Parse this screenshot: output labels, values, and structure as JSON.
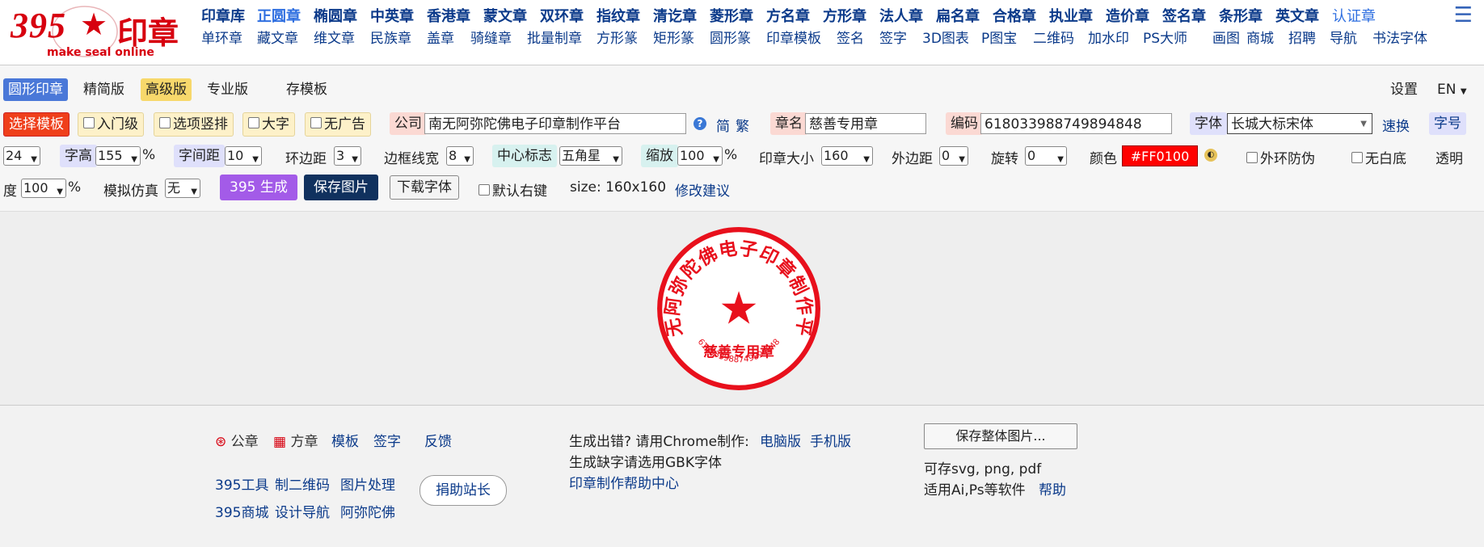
{
  "logo": {
    "number": "395",
    "star": "★",
    "text": "印章",
    "subtitle": "make seal online"
  },
  "nav_row1": [
    "印章库",
    "正圆章",
    "椭圆章",
    "中英章",
    "香港章",
    "蒙文章",
    "双环章",
    "指纹章",
    "清讫章",
    "菱形章",
    "方名章",
    "方形章",
    "法人章",
    "扁名章",
    "合格章",
    "执业章",
    "造价章",
    "签名章",
    "条形章",
    "英文章",
    "认证章"
  ],
  "nav_row2": [
    "单环章",
    "藏文章",
    "维文章",
    "民族章",
    "盖章",
    "骑缝章",
    "批量制章",
    "方形篆",
    "矩形篆",
    "圆形篆",
    "印章模板",
    "签名",
    "签字",
    "3D图表",
    "P图宝",
    "二维码",
    "加水印",
    "PS大师",
    "画图",
    "商城",
    "招聘",
    "导航",
    "书法字体"
  ],
  "menu_icon": "menu-icon",
  "tabs": {
    "round": "圆形印章",
    "simple": "精简版",
    "advanced": "高级版",
    "pro": "专业版",
    "save_tpl": "存模板",
    "settings": "设置",
    "lang": "EN"
  },
  "row2": {
    "choose_template": "选择模板",
    "beginner": "入门级",
    "vertical": "选项竖排",
    "large": "大字",
    "no_ads": "无广告",
    "company_label": "公司",
    "company_value": "南无阿弥陀佛电子印章制作平台",
    "simplified": "简",
    "traditional": "繁",
    "name_label": "章名",
    "name_value": "慈善专用章",
    "code_label": "编码",
    "code_value": "618033988749894848",
    "font_label": "字体",
    "font_value": "长城大标宋体",
    "quick": "速换",
    "size_label": "字号"
  },
  "row3": {
    "font_size": "24",
    "char_height_label": "字高",
    "char_height": "155",
    "pct": "%",
    "spacing_label": "字间距",
    "spacing": "10",
    "ring_margin_label": "环边距",
    "ring_margin": "3",
    "border_label": "边框线宽",
    "border": "8",
    "center_label": "中心标志",
    "center": "五角星",
    "zoom_label": "缩放",
    "zoom": "100",
    "seal_size_label": "印章大小",
    "seal_size": "160",
    "outer_margin_label": "外边距",
    "outer_margin": "0",
    "rotate_label": "旋转",
    "rotate": "0",
    "color_label": "颜色",
    "color_value": "#FF0100",
    "anti_fake": "外环防伪",
    "no_white": "无白底",
    "transparent": "透明"
  },
  "row4": {
    "degree": "度",
    "opacity": "100",
    "pct": "%",
    "simulate_label": "模拟仿真",
    "simulate": "无",
    "generate": "395 生成",
    "save_image": "保存图片",
    "download_font": "下载字体",
    "right_key": "默认右键",
    "size_text": "size: 160x160",
    "suggest": "修改建议"
  },
  "seal": {
    "company": "南无阿弥陀佛电子印章制作平台",
    "name": "慈善专用章",
    "code": "618033988749894848",
    "star": "★",
    "color": "#e8101c"
  },
  "footer": {
    "official": "公章",
    "square": "方章",
    "template": "模板",
    "sign": "签字",
    "feedback": "反馈",
    "tools": "395工具",
    "qr": "制二维码",
    "img": "图片处理",
    "donate": "捐助站长",
    "mall": "395商城",
    "design_nav": "设计导航",
    "amitabha": "阿弥陀佛",
    "error_text": "生成出错? 请用Chrome制作:",
    "pc": "电脑版",
    "mobile": "手机版",
    "gbk": "生成缺字请选用GBK字体",
    "help_center": "印章制作帮助中心",
    "save_all": "保存整体图片...",
    "formats": "可存svg, png, pdf",
    "software": "适用Ai,Ps等软件",
    "help": "帮助"
  },
  "colors": {
    "brand_red": "#d7000f",
    "link_blue": "#0b3a8a",
    "active_tab": "#4a78d8",
    "gen_button": "#a35be8",
    "save_button": "#10315e",
    "choose_button": "#ef3f1b"
  }
}
